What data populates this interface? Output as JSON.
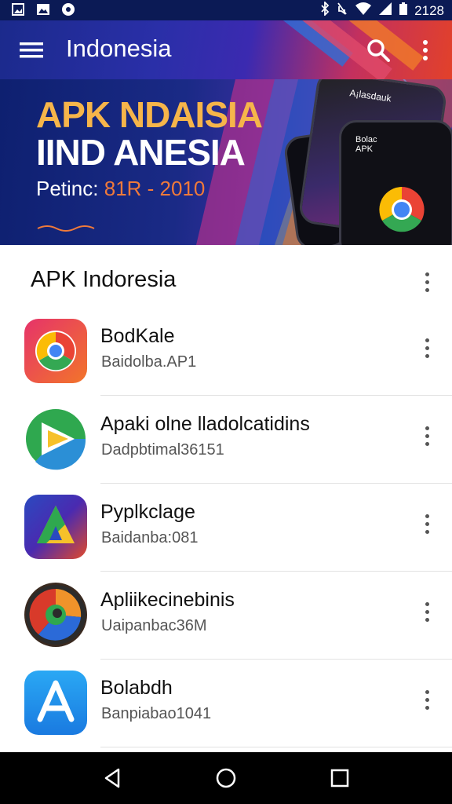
{
  "status_bar": {
    "time": "2128",
    "icons": [
      "photo-icon",
      "gallery-icon",
      "circle-icon",
      "bluetooth-icon",
      "mute-icon",
      "wifi-icon",
      "signal-icon",
      "battery-icon"
    ]
  },
  "app_bar": {
    "title": "Indonesia",
    "menu_icon": "menu-icon",
    "search_icon": "search-icon",
    "overflow_icon": "more-vert-icon"
  },
  "banner": {
    "line1": "APK NDAISIA",
    "line2": "IIND ANESIA",
    "sub_prefix": "Petinc:",
    "sub_value": "81R - 2010",
    "phone1_text": "A¡lasdauk",
    "phone2_text": "Bolac\nAPK"
  },
  "section": {
    "title": "APK Indoresia"
  },
  "apps": [
    {
      "name": "BodKale",
      "subtitle": "Baidolba.AP1",
      "icon": "chrome-like-icon"
    },
    {
      "name": "Apaki olne lladolcatidins",
      "subtitle": "Dadpbtimal36151",
      "icon": "play-like-icon"
    },
    {
      "name": "Pyplkclage",
      "subtitle": "Baidanba:081",
      "icon": "drive-like-icon"
    },
    {
      "name": "Apliikecinebinis",
      "subtitle": "Uaipanbac36M",
      "icon": "swirl-icon"
    },
    {
      "name": "Bolabdh",
      "subtitle": "Banpiabao1041",
      "icon": "appstore-like-icon"
    }
  ],
  "nav_bar": {
    "back": "back-icon",
    "home": "home-icon",
    "recents": "recents-icon"
  },
  "colors": {
    "status_bg": "#0b1a55",
    "nav_bg": "#000000",
    "accent_orange": "#f6b54a",
    "accent_red": "#e2412a"
  }
}
